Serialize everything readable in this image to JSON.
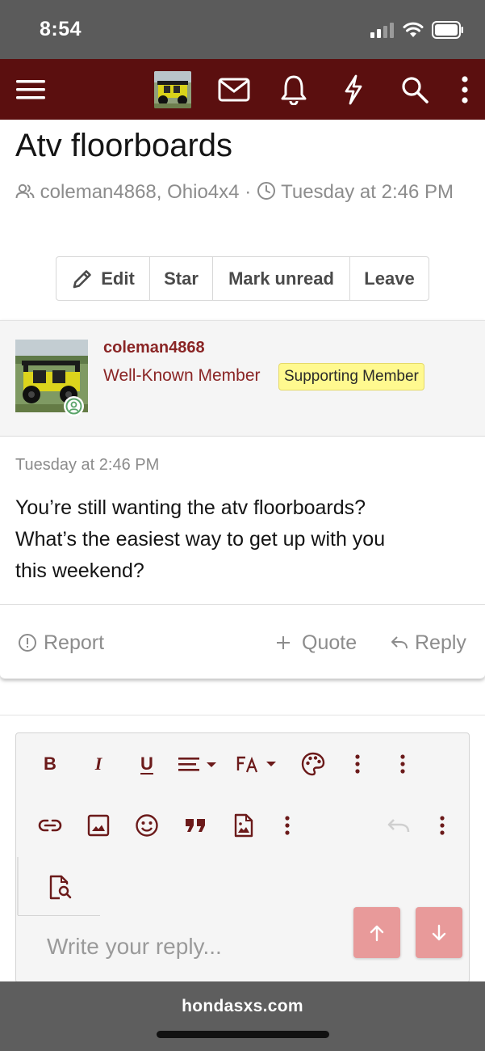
{
  "status_bar": {
    "time": "8:54"
  },
  "header": {
    "icons": [
      "menu-icon",
      "inbox-icon",
      "bell-icon",
      "bolt-icon",
      "search-icon",
      "more-icon"
    ]
  },
  "thread": {
    "title": "Atv floorboards",
    "participants": "coleman4868, Ohio4x4",
    "separator": "·",
    "date": "Tuesday at 2:46 PM",
    "actions": {
      "edit": "Edit",
      "star": "Star",
      "mark_unread": "Mark unread",
      "leave": "Leave"
    }
  },
  "post": {
    "username": "coleman4868",
    "user_title": "Well-Known Member",
    "badge": "Supporting Member",
    "date": "Tuesday at 2:46 PM",
    "body_lines": [
      "You’re still wanting the atv floorboards?",
      "What’s the easiest way to get up with you",
      "this weekend?"
    ],
    "footer": {
      "report": "Report",
      "quote": "Quote",
      "reply": "Reply"
    }
  },
  "editor": {
    "toolbar_row1": [
      "bold",
      "italic",
      "underline",
      "align",
      "font-size",
      "color",
      "more",
      "more"
    ],
    "toolbar_row2": [
      "link",
      "image",
      "smilie",
      "quote",
      "attach",
      "more",
      "undo",
      "more"
    ],
    "toolbar_row3": [
      "preview"
    ],
    "bold_glyph": "B",
    "italic_glyph": "I",
    "underline_glyph": "U",
    "placeholder": "Write your reply..."
  },
  "browser": {
    "url": "hondasxs.com"
  },
  "colors": {
    "header": "#5b0f0f",
    "accent": "#8a2525",
    "badge": "#fff98f",
    "jump_button": "#e89a9a"
  }
}
